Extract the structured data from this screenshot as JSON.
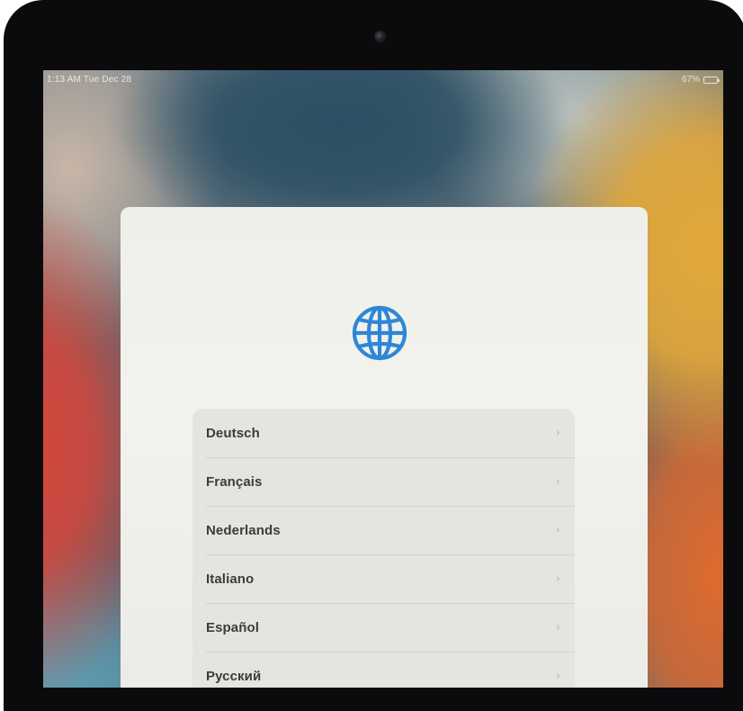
{
  "status_bar": {
    "time_date": "1:13 AM  Tue Dec 28",
    "battery_text": "67%",
    "battery_level": 0.67
  },
  "setup": {
    "icon": "globe-icon",
    "accent_color": "#2f86d6",
    "languages": [
      {
        "label": "Deutsch"
      },
      {
        "label": "Français"
      },
      {
        "label": "Nederlands"
      },
      {
        "label": "Italiano"
      },
      {
        "label": "Español"
      },
      {
        "label": "Русский"
      }
    ],
    "chevron": "›"
  }
}
